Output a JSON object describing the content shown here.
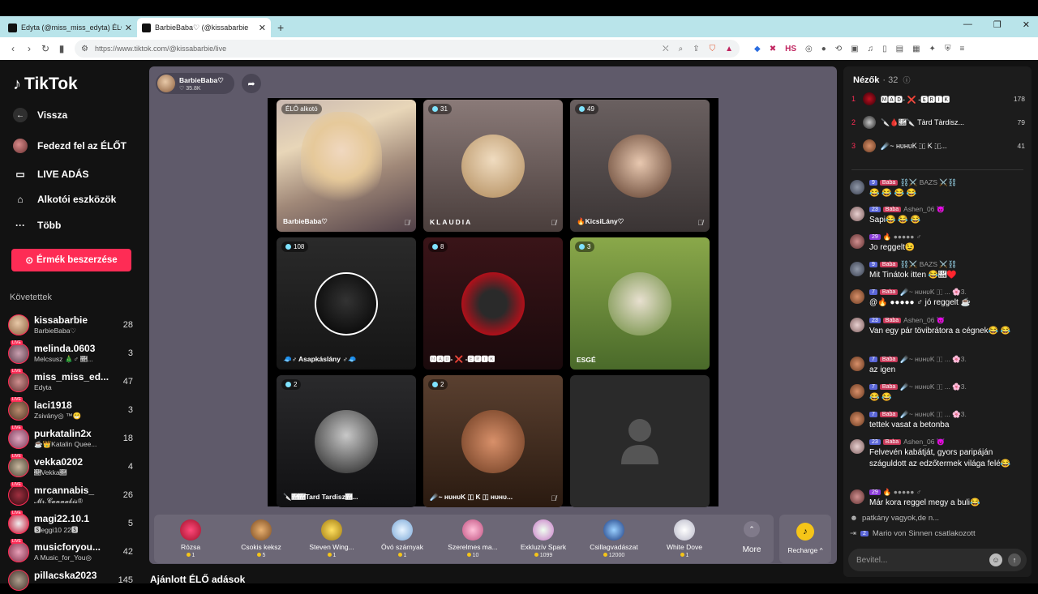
{
  "browser": {
    "tabs": [
      {
        "title": "Edyta (@miss_miss_edyta) ÉLŐ adás"
      },
      {
        "title": "BarbieBaba♡ (@kissabarbie"
      }
    ],
    "url": "https://www.tiktok.com/@kissabarbie/live"
  },
  "sidebar": {
    "logo": "TikTok",
    "nav": [
      {
        "label": "Vissza",
        "icon": "back-arrow-icon"
      },
      {
        "label": "Fedezd fel az ÉLŐT",
        "icon": "avatar-icon"
      },
      {
        "label": "LIVE ADÁS",
        "icon": "live-camera-icon"
      },
      {
        "label": "Alkotói eszközök",
        "icon": "creator-tools-icon"
      },
      {
        "label": "Több",
        "icon": "more-dots-icon"
      }
    ],
    "coins_button": "Érmék beszerzése",
    "following_title": "Követettek",
    "following": [
      {
        "name": "kissabarbie",
        "sub": "BarbieBaba♡",
        "count": "28"
      },
      {
        "name": "melinda.0603",
        "sub": "Melcsusz 🎄♂ 🛛...",
        "count": "3"
      },
      {
        "name": "miss_miss_ed...",
        "sub": "Edyta",
        "count": "47"
      },
      {
        "name": "laci1918",
        "sub": "Zsivány◎ ™😁",
        "count": "3"
      },
      {
        "name": "purkatalin2x",
        "sub": "☕👑Katalin Quee...",
        "count": "18"
      },
      {
        "name": "vekka0202",
        "sub": "🛛Vekka🛛",
        "count": "4"
      },
      {
        "name": "mrcannabis_",
        "sub": "𝓜𝓻.𝓒𝓪𝓷𝓷𝓪𝓫𝓲𝓼®",
        "count": "26"
      },
      {
        "name": "magi22.10.1",
        "sub": "🆂eggi10 22🆂",
        "count": "5"
      },
      {
        "name": "musicforyou...",
        "sub": "A Music_for_You◎",
        "count": "42"
      },
      {
        "name": "pillacska2023",
        "sub": "",
        "count": "145"
      }
    ]
  },
  "host": {
    "name": "BarbieBaba♡",
    "viewers": "35.8K"
  },
  "grid": [
    {
      "badge": "ÉLŐ alkotó",
      "label": "BarbieBaba♡"
    },
    {
      "badge": "31",
      "label": "KLAUDIA"
    },
    {
      "badge": "49",
      "label": "🔥KicsiLány♡"
    },
    {
      "badge": "108",
      "label": "🧢♂ Asapkáslány ♂🧢"
    },
    {
      "badge": "8",
      "label": "🅼🅰🅳- ❌ -🅴🆁🅸🅺"
    },
    {
      "badge": "3",
      "label": "ESGÉ"
    },
    {
      "badge": "2",
      "label": "🔪🛛🛛Tard Tardisz🛛..."
    },
    {
      "badge": "2",
      "label": "☄️~ ʜᴜʜᴜK 🇮 K 🇮 ʜᴜʜᴜ..."
    },
    {
      "badge": "",
      "label": ""
    }
  ],
  "gifts": [
    {
      "name": "Rózsa",
      "price": "1",
      "color": "#e0245e"
    },
    {
      "name": "Csokis keksz",
      "price": "5",
      "color": "#c9873a"
    },
    {
      "name": "Steven Wing...",
      "price": "1",
      "color": "#e8c53a"
    },
    {
      "name": "Óvó szárnyak",
      "price": "1",
      "color": "#b8d8f5"
    },
    {
      "name": "Szerelmes ma...",
      "price": "10",
      "color": "#f09ac0"
    },
    {
      "name": "Exkluzív Spark",
      "price": "1099",
      "color": "#c8f0d0"
    },
    {
      "name": "Csillagvadászat",
      "price": "12000",
      "color": "#3a7ad8"
    },
    {
      "name": "White Dove",
      "price": "1",
      "color": "#f4f4f4"
    }
  ],
  "more_label": "More",
  "recharge_label": "Recharge ^",
  "recommended_title": "Ajánlott ÉLŐ adások",
  "chat": {
    "viewers_label": "Nézők",
    "viewers_count": "· 32",
    "ranking": [
      {
        "rank": "1",
        "name": "🅼🅰🅳- ❌ -🅴🆁🅸🅺",
        "score": "178"
      },
      {
        "rank": "2",
        "name": "🔪🩸🛛🔪 Tàrd Tàrdisz...",
        "score": "79"
      },
      {
        "rank": "3",
        "name": "☄️~ ʜᴜʜᴜK 🇮 K 🇮...",
        "score": "41"
      }
    ],
    "messages": [
      {
        "level": "9",
        "fan": "Baba",
        "user": "⛓️⚔️ BAZS ⚔️⛓️",
        "text": "😂 😂 😂 😂"
      },
      {
        "level": "23",
        "fan": "Baba",
        "user": "Ashen_06 😈",
        "text": "Sapi😂 😂 😂"
      },
      {
        "level": "29",
        "fan": "",
        "user": "🔥 ●●●●● ♂",
        "text": "Jo reggelt😉"
      },
      {
        "level": "9",
        "fan": "Baba",
        "user": "⛓️⚔️ BAZS ⚔️⛓️",
        "text": "Mit Tinátok itten 😂🛛♥️"
      },
      {
        "level": "7",
        "fan": "Baba",
        "user": "☄️~ ʜᴜʜᴜK 🇮 ... 🌸3.",
        "text": "@🔥 ●●●●● ♂ jó reggelt ☕"
      },
      {
        "level": "23",
        "fan": "Baba",
        "user": "Ashen_06 😈",
        "text": "Van egy pár tövibrátora a cégnek😂 😂"
      },
      {
        "level": "7",
        "fan": "Baba",
        "user": "☄️~ ʜᴜʜᴜK 🇮 ... 🌸3.",
        "text": "az igen"
      },
      {
        "level": "7",
        "fan": "Baba",
        "user": "☄️~ ʜᴜʜᴜK 🇮 ... 🌸3.",
        "text": "😂 😂"
      },
      {
        "level": "7",
        "fan": "Baba",
        "user": "☄️~ ʜᴜʜᴜK 🇮 ... 🌸3.",
        "text": "tettek vasat a betonba"
      },
      {
        "level": "23",
        "fan": "Baba",
        "user": "Ashen_06 😈",
        "text": "Felvevén kabátját, gyors paripáján száguldott az edzőtermek világa felé😂"
      },
      {
        "level": "29",
        "fan": "",
        "user": "🔥 ●●●●● ♂",
        "text": "Már kora reggel megy a buli😂"
      }
    ],
    "system": [
      {
        "text": "patkány vagyok,de n..."
      },
      {
        "level": "2",
        "text": "Mario von Sinnen  csatlakozott"
      }
    ],
    "input_placeholder": "Bevitel..."
  }
}
